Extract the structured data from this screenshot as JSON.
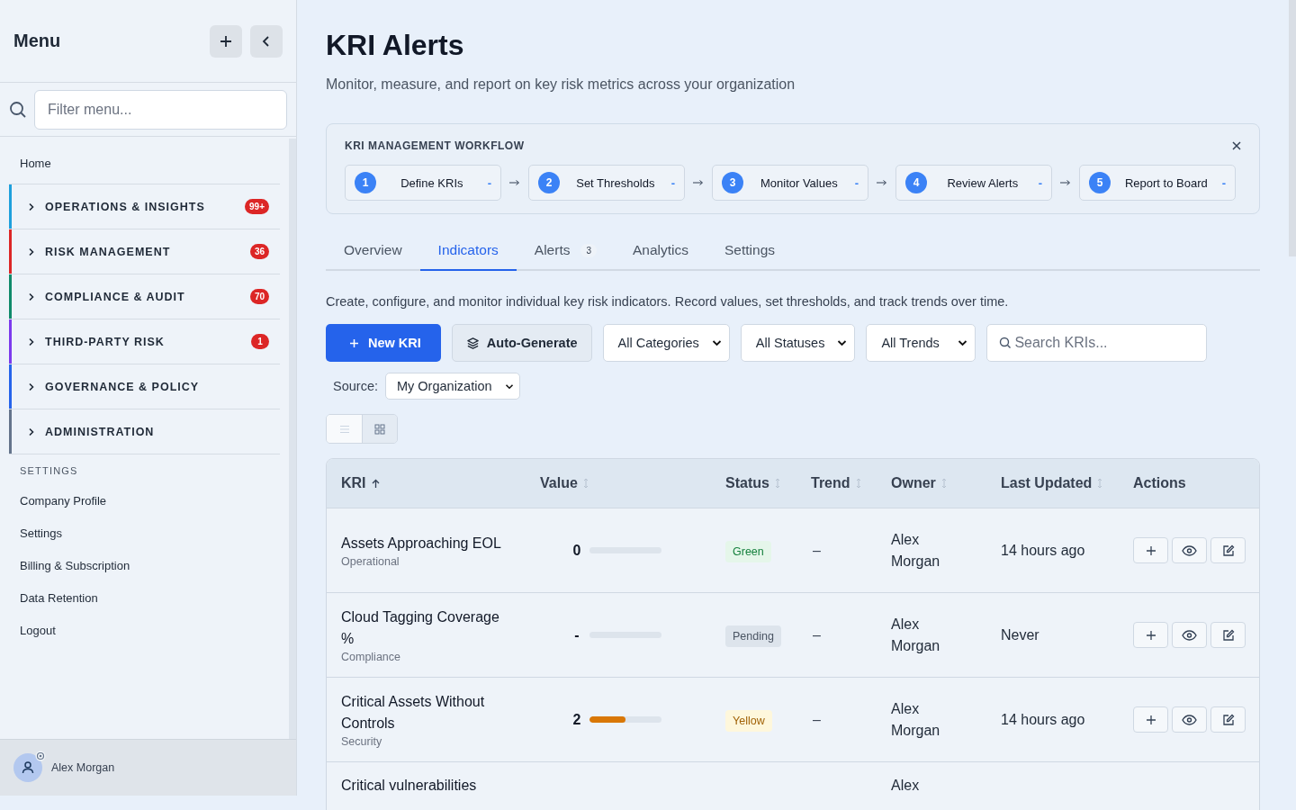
{
  "sidebar": {
    "title": "Menu",
    "filter": {
      "placeholder": "Filter menu..."
    },
    "home": "Home",
    "groups": [
      {
        "label": "OPERATIONS & INSIGHTS",
        "color": "#1ea0dc",
        "badge": "99+"
      },
      {
        "label": "RISK MANAGEMENT",
        "color": "#dc2626",
        "badge": "36"
      },
      {
        "label": "COMPLIANCE & AUDIT",
        "color": "#0f8a6a",
        "badge": "70"
      },
      {
        "label": "THIRD-PARTY RISK",
        "color": "#7c3aed",
        "badge": "1"
      },
      {
        "label": "GOVERNANCE & POLICY",
        "color": "#2563eb"
      },
      {
        "label": "ADMINISTRATION",
        "color": "#64748b"
      }
    ],
    "settings_header": "SETTINGS",
    "settings_items": [
      "Company Profile",
      "Settings",
      "Billing & Subscription",
      "Data Retention",
      "Logout"
    ],
    "user": "Alex Morgan"
  },
  "page": {
    "title": "KRI Alerts",
    "subtitle": "Monitor, measure, and report on key risk metrics across your organization"
  },
  "workflow": {
    "title": "KRI MANAGEMENT WORKFLOW",
    "steps": [
      {
        "number": "1",
        "label": "Define KRIs",
        "status": "-"
      },
      {
        "number": "2",
        "label": "Set Thresholds",
        "status": "-"
      },
      {
        "number": "3",
        "label": "Monitor Values",
        "status": "-"
      },
      {
        "number": "4",
        "label": "Review Alerts",
        "status": "-"
      },
      {
        "number": "5",
        "label": "Report to Board",
        "status": "-"
      }
    ]
  },
  "tabs": [
    {
      "label": "Overview",
      "selected": false
    },
    {
      "label": "Indicators",
      "selected": true
    },
    {
      "label": "Alerts",
      "selected": false,
      "count": "3"
    },
    {
      "label": "Analytics",
      "selected": false
    },
    {
      "label": "Settings",
      "selected": false
    }
  ],
  "description": "Create, configure, and monitor individual key risk indicators. Record values, set thresholds, and track trends over time.",
  "toolbar": {
    "new_button": "New KRI",
    "auto_button": "Auto-Generate",
    "filters": [
      {
        "value": "All Categories"
      },
      {
        "value": "All Statuses"
      },
      {
        "value": "All Trends"
      }
    ],
    "search": {
      "placeholder": "Search KRIs..."
    },
    "source_label": "Source:",
    "source_value": "My Organization"
  },
  "view_toggle": [
    {
      "kind": "list",
      "selected": true
    },
    {
      "kind": "grid",
      "selected": false
    }
  ],
  "table": {
    "columns": [
      {
        "label": "KRI",
        "sorted": true
      },
      {
        "label": "Value",
        "sorted": false
      },
      {
        "label": "Status",
        "sorted": false
      },
      {
        "label": "Trend",
        "sorted": false
      },
      {
        "label": "Owner",
        "sorted": false
      },
      {
        "label": "Last Updated",
        "sorted": false
      },
      {
        "label": "Actions"
      }
    ],
    "rows": [
      {
        "name": "Assets Approaching EOL",
        "category": "Operational",
        "value": "0",
        "level": 0,
        "status": {
          "label": "Green",
          "kind": "green"
        },
        "trend": "–",
        "owner": "Alex Morgan",
        "updated": "14 hours ago"
      },
      {
        "name": "Cloud Tagging Coverage %",
        "category": "Compliance",
        "value": "-",
        "level": 0,
        "status": {
          "label": "Pending",
          "kind": "pending"
        },
        "trend": "–",
        "owner": "Alex Morgan",
        "updated": "Never"
      },
      {
        "name": "Critical Assets Without Controls",
        "category": "Security",
        "value": "2",
        "level": 0.5,
        "status": {
          "label": "Yellow",
          "kind": "yellow"
        },
        "trend": "–",
        "owner": "Alex Morgan",
        "updated": "14 hours ago"
      },
      {
        "name": "Critical vulnerabilities",
        "owner": "Alex"
      }
    ]
  }
}
